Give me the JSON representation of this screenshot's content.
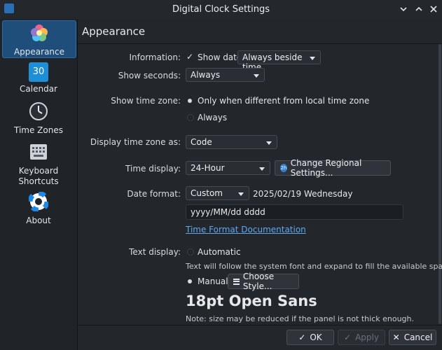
{
  "window": {
    "title": "Digital Clock Settings"
  },
  "sidebar": {
    "items": [
      {
        "label": "Appearance",
        "icon": "appearance-icon",
        "active": true
      },
      {
        "label": "Calendar",
        "icon": "calendar-icon",
        "calendar_day": "30"
      },
      {
        "label": "Time Zones",
        "icon": "clock-icon"
      },
      {
        "label": "Keyboard Shortcuts",
        "icon": "keyboard-icon"
      },
      {
        "label": "About",
        "icon": "lifebuoy-icon"
      }
    ]
  },
  "main": {
    "section_title": "Appearance",
    "information": {
      "label": "Information:",
      "checkbox_label": "Show date",
      "checked": true,
      "combo_value": "Always beside time"
    },
    "show_seconds": {
      "label": "Show seconds:",
      "combo_value": "Always"
    },
    "show_time_zone": {
      "label": "Show time zone:",
      "option_1": "Only when different from local time zone",
      "option_2": "Always",
      "selected": "option_1"
    },
    "display_time_zone": {
      "label": "Display time zone as:",
      "combo_value": "Code"
    },
    "time_display": {
      "label": "Time display:",
      "combo_value": "24-Hour",
      "button_label": "Change Regional Settings..."
    },
    "date_format": {
      "label": "Date format:",
      "combo_value": "Custom",
      "preview": "2025/02/19 Wednesday",
      "pattern": "yyyy/MM/dd dddd",
      "link": "Time Format Documentation"
    },
    "text_display": {
      "label": "Text display:",
      "option_auto": "Automatic",
      "auto_note": "Text will follow the system font and expand to fill the available space.",
      "option_manual": "Manual",
      "selected": "manual",
      "choose_style_button": "Choose Style...",
      "font_preview": "18pt Open Sans",
      "note": "Note: size may be reduced if the panel is not thick enough."
    }
  },
  "footer": {
    "ok_label": "OK",
    "apply_label": "Apply",
    "cancel_label": "Cancel"
  },
  "colors": {
    "accent": "#1f4e7a",
    "link": "#5fa8ef",
    "background": "#23262b"
  }
}
